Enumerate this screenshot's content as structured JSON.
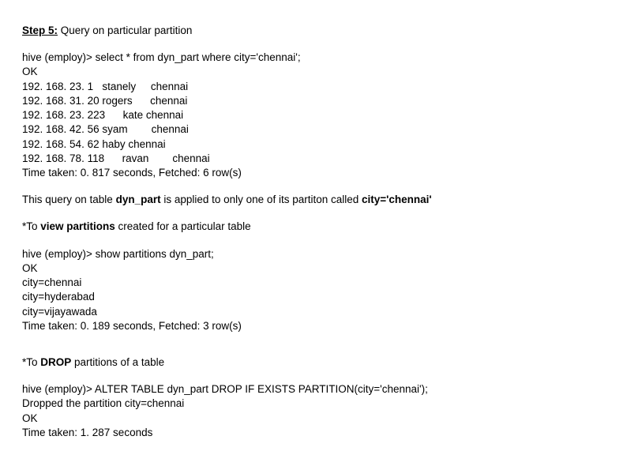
{
  "step5": {
    "label_bold": "Step 5:",
    "label_rest": " Query on particular partition"
  },
  "query1": {
    "cmd": "hive (employ)> select * from dyn_part where city='chennai';",
    "ok": "OK",
    "rows": [
      "192. 168. 23. 1   stanely     chennai",
      "192. 168. 31. 20 rogers      chennai",
      "192. 168. 23. 223      kate chennai",
      "192. 168. 42. 56 syam        chennai",
      "192. 168. 54. 62 haby chennai",
      "192. 168. 78. 118      ravan        chennai"
    ],
    "time": "Time taken: 0. 817 seconds, Fetched: 6 row(s)"
  },
  "explain": {
    "pre": "This query on table ",
    "b1": "dyn_part",
    "mid": " is applied to only one of its partiton called ",
    "b2": "city='chennai'"
  },
  "view_part": {
    "pre": "*To ",
    "b": "view partitions",
    "post": " created for a particular table"
  },
  "query2": {
    "cmd": "hive (employ)> show partitions dyn_part;",
    "ok": "OK",
    "rows": [
      "city=chennai",
      "city=hyderabad",
      "city=vijayawada"
    ],
    "time": "Time taken: 0. 189 seconds, Fetched: 3 row(s)"
  },
  "drop_part": {
    "pre": "*To ",
    "b": "DROP",
    "post": " partitions of a table"
  },
  "query3": {
    "cmd": "hive (employ)> ALTER TABLE dyn_part DROP IF EXISTS PARTITION(city='chennai');",
    "dropped": "Dropped the partition city=chennai",
    "ok": "OK",
    "time": "Time taken: 1. 287 seconds"
  }
}
